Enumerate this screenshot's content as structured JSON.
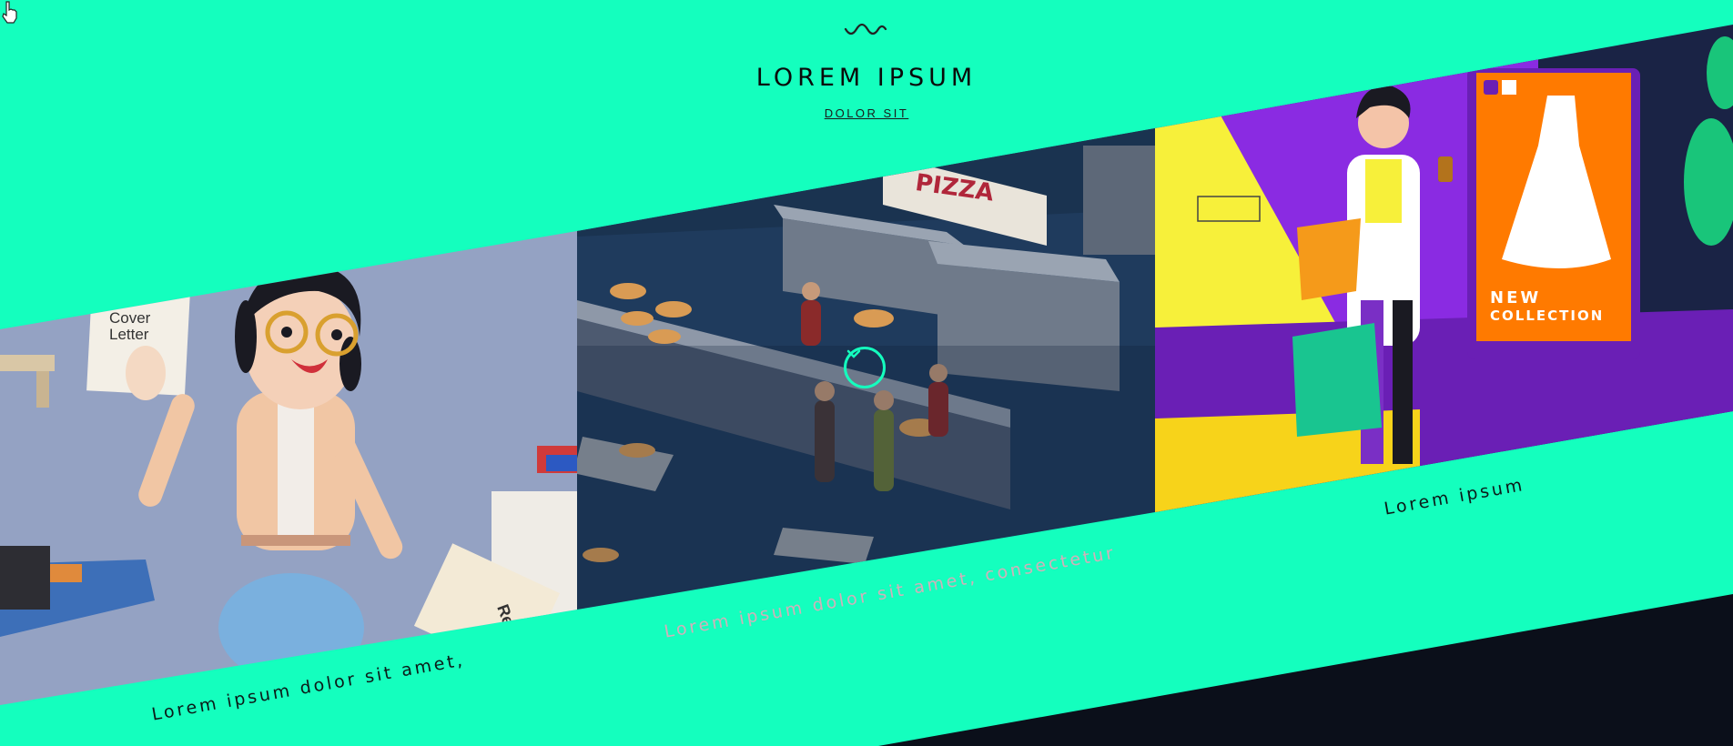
{
  "header": {
    "title": "LOREM IPSUM",
    "subtitle": "DOLOR SIT"
  },
  "panels": [
    {
      "caption": "Lorem ipsum dolor sit amet,",
      "card1": "Cover",
      "card2": "Letter",
      "card3": "Res"
    },
    {
      "caption": "Lorem ipsum dolor sit amet, consectetur",
      "sign": "PIZZA",
      "button_icon": "chevron-down-icon"
    },
    {
      "caption": "Lorem ipsum",
      "poster_line1": "NEW",
      "poster_line2": "COLLECTION"
    }
  ],
  "colors": {
    "accent": "#14ffbe",
    "dark": "#0b0f1a",
    "panel_left_bg": "#8e9cc0",
    "panel_mid_bg": "#1e3a5c",
    "panel_right_purple": "#8a2be2",
    "panel_right_yellow": "#f7f03a",
    "poster_orange": "#ff7a00"
  }
}
